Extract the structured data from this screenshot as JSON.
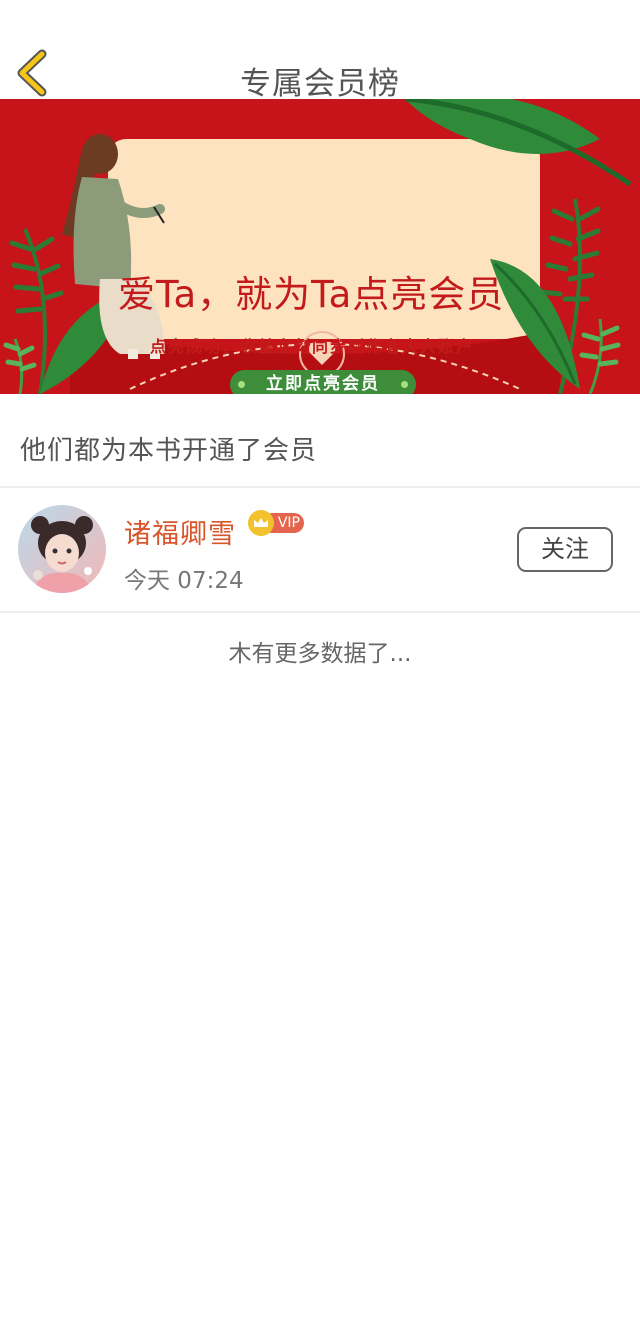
{
  "header": {
    "title": "专属会员榜",
    "back_icon": "chevron-left-icon"
  },
  "banner": {
    "headline": "爱Ta，就为Ta点亮会员",
    "subtitle": "点亮成功，收益立刻同步到作者大大账户",
    "cta_label": "立即点亮会员",
    "colors": {
      "background": "#c6141a",
      "card": "#fde3c0",
      "cta": "#3d8d3b"
    }
  },
  "section": {
    "heading": "他们都为本书开通了会员"
  },
  "members": [
    {
      "name": "诸福卿雪",
      "badge": "VIP",
      "time": "今天 07:24",
      "follow_label": "关注"
    }
  ],
  "footer": {
    "no_more": "木有更多数据了..."
  },
  "colors": {
    "accent_name": "#d9552b",
    "vip_badge": "#e5644d",
    "crown": "#f2c12e",
    "back_icon": "#f5c518"
  }
}
